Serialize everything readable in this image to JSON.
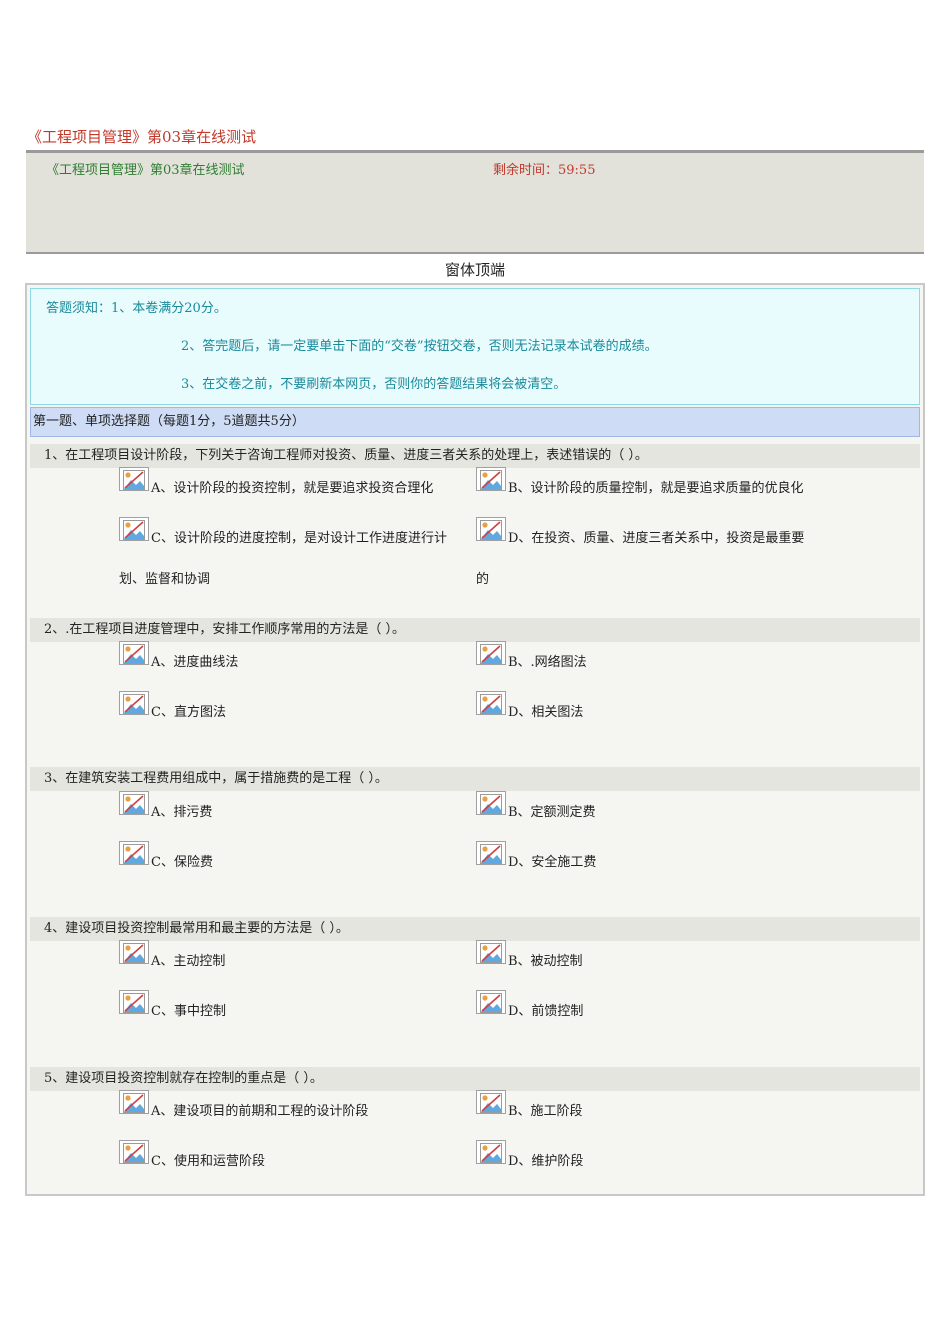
{
  "page_title": "《工程项目管理》第03章在线测试",
  "header": {
    "title": "《工程项目管理》第03章在线测试",
    "timer": "剩余时间：59:55"
  },
  "form_top": "窗体顶端",
  "notice": {
    "line1": "答题须知：1、本卷满分20分。",
    "line2": "2、答完题后，请一定要单击下面的“交卷”按钮交卷，否则无法记录本试卷的成绩。",
    "line3": "3、在交卷之前，不要刷新本网页，否则你的答题结果将会被清空。"
  },
  "section_title": "第一题、单项选择题（每题1分，5道题共5分）",
  "questions": [
    {
      "text": "1、在工程项目设计阶段，下列关于咨询工程师对投资、质量、进度三者关系的处理上，表述错误的（ ）。",
      "options": {
        "a": "A、设计阶段的投资控制，就是要追求投资合理化",
        "b": "B、设计阶段的质量控制，就是要追求质量的优良化",
        "c": "C、设计阶段的进度控制，是对设计工作进度进行计",
        "c2": "划、监督和协调",
        "d": "D、在投资、质量、进度三者关系中，投资是最重要",
        "d2": "的"
      }
    },
    {
      "text": "2、.在工程项目进度管理中，安排工作顺序常用的方法是（ ）。",
      "options": {
        "a": "A、进度曲线法",
        "b": "B、.网络图法",
        "c": "C、直方图法",
        "d": "D、相关图法"
      }
    },
    {
      "text": "3、在建筑安装工程费用组成中，属于措施费的是工程（ ）。",
      "options": {
        "a": "A、排污费",
        "b": "B、定额测定费",
        "c": "C、保险费",
        "d": "D、安全施工费"
      }
    },
    {
      "text": "4、建设项目投资控制最常用和最主要的方法是（ ）。",
      "options": {
        "a": "A、主动控制",
        "b": "B、被动控制",
        "c": "C、事中控制",
        "d": "D、前馈控制"
      }
    },
    {
      "text": "5、建设项目投资控制就存在控制的重点是（ ）。",
      "options": {
        "a": "A、建设项目的前期和工程的设计阶段",
        "b": "B、施工阶段",
        "c": "C、使用和运营阶段",
        "d": "D、维护阶段"
      }
    }
  ],
  "icon": "broken-image-icon"
}
